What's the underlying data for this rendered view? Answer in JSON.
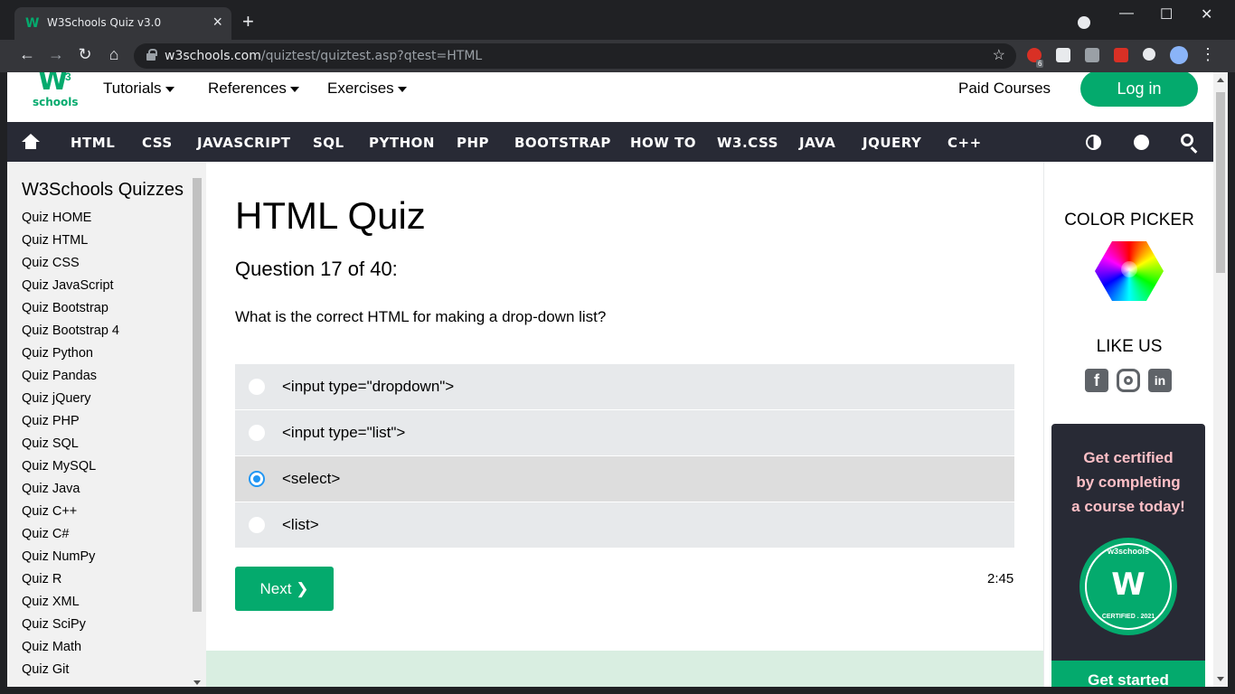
{
  "browser": {
    "tab_title": "W3Schools Quiz v3.0",
    "tab_favicon": "W",
    "url_host": "w3schools.com",
    "url_path": "/quiztest/quiztest.asp?qtest=HTML",
    "ext_badge": "6"
  },
  "topnav": {
    "logo_text": "schools",
    "logo_mark": "W",
    "logo_sup": "3",
    "menus": [
      "Tutorials",
      "References",
      "Exercises"
    ],
    "paid_courses": "Paid Courses",
    "login": "Log in"
  },
  "darknav": {
    "items": [
      "HTML",
      "CSS",
      "JAVASCRIPT",
      "SQL",
      "PYTHON",
      "PHP",
      "BOOTSTRAP",
      "HOW TO",
      "W3.CSS",
      "JAVA",
      "JQUERY",
      "C++"
    ]
  },
  "sidebar": {
    "title": "W3Schools Quizzes",
    "items": [
      "Quiz HOME",
      "Quiz HTML",
      "Quiz CSS",
      "Quiz JavaScript",
      "Quiz Bootstrap",
      "Quiz Bootstrap 4",
      "Quiz Python",
      "Quiz Pandas",
      "Quiz jQuery",
      "Quiz PHP",
      "Quiz SQL",
      "Quiz MySQL",
      "Quiz Java",
      "Quiz C++",
      "Quiz C#",
      "Quiz NumPy",
      "Quiz R",
      "Quiz XML",
      "Quiz SciPy",
      "Quiz Math",
      "Quiz Git"
    ]
  },
  "quiz": {
    "title": "HTML Quiz",
    "question_number": "Question 17 of 40:",
    "question": "What is the correct HTML for making a drop-down list?",
    "options": [
      "<input type=\"dropdown\">",
      "<input type=\"list\">",
      "<select>",
      "<list>"
    ],
    "selected_index": 2,
    "next_label": "Next ❯",
    "timer": "2:45"
  },
  "right": {
    "color_picker": "COLOR PICKER",
    "like_us": "LIKE US",
    "cert_line1": "Get certified",
    "cert_line2": "by completing",
    "cert_line3": "a course today!",
    "badge_top": "w3schools",
    "badge_mark": "W",
    "badge_bottom": "CERTIFIED . 2021",
    "get_started": "Get started"
  },
  "colors": {
    "brand_green": "#04aa6d",
    "dark_nav": "#282a35",
    "radio_blue": "#2196f3"
  }
}
